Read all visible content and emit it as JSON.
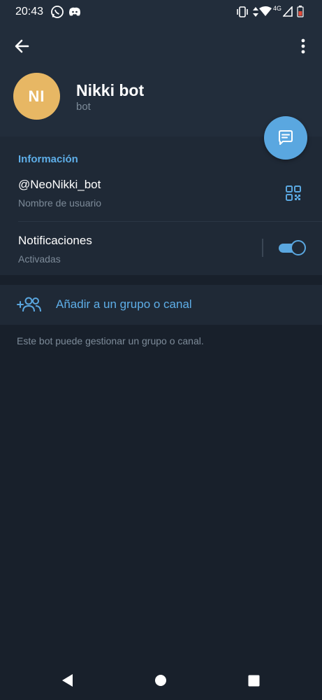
{
  "status_bar": {
    "time": "20:43",
    "network": "4G",
    "icons": [
      "whatsapp-icon",
      "discord-icon",
      "vibrate-icon",
      "data-arrows-icon",
      "wifi-icon",
      "signal-icon",
      "battery-icon"
    ]
  },
  "toolbar": {
    "back_icon": "arrow-left-icon",
    "more_icon": "vertical-dots-icon"
  },
  "profile": {
    "initials": "NI",
    "avatar_color": "#e7b764",
    "name": "Nikki bot",
    "subtitle": "bot"
  },
  "fab": {
    "icon": "message-icon",
    "color": "#5aa7e0"
  },
  "info": {
    "title": "Información",
    "username": "@NeoNikki_bot",
    "username_label": "Nombre de usuario",
    "notifications_title": "Notificaciones",
    "notifications_status": "Activadas",
    "notifications_enabled": true
  },
  "add_group": {
    "label": "Añadir a un grupo o canal",
    "hint": "Este bot puede gestionar un grupo o canal."
  },
  "colors": {
    "accent": "#5aa7e0",
    "background": "#18202b",
    "header": "#222d3b",
    "section": "#1f2936"
  },
  "nav": {
    "icons": [
      "back-triangle-icon",
      "home-circle-icon",
      "recents-square-icon"
    ]
  }
}
